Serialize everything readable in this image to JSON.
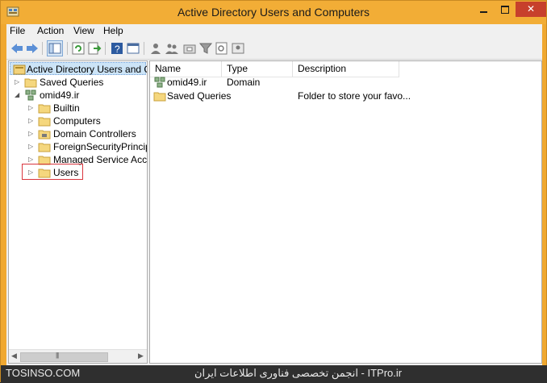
{
  "window": {
    "title": "Active Directory Users and Computers",
    "close_label": "✕"
  },
  "menu": {
    "file": "File",
    "action": "Action",
    "view": "View",
    "help": "Help"
  },
  "colors": {
    "accent_frame": "#f2ad36",
    "selection": "#cce4f7",
    "highlight_box": "#d9363e"
  },
  "tree": {
    "root": "Active Directory Users and Com",
    "saved_queries": "Saved Queries",
    "domain": "omid49.ir",
    "children": {
      "builtin": "Builtin",
      "computers": "Computers",
      "domain_controllers": "Domain Controllers",
      "foreign_security_principals": "ForeignSecurityPrincipals",
      "managed_service_accounts": "Managed Service Accour",
      "users": "Users"
    }
  },
  "list": {
    "headers": {
      "name": "Name",
      "type": "Type",
      "description": "Description"
    },
    "rows": [
      {
        "name": "omid49.ir",
        "type": "Domain",
        "description": ""
      },
      {
        "name": "Saved Queries",
        "type": "",
        "description": "Folder to store your favo..."
      }
    ]
  },
  "footer": {
    "left": "TOSINSO.COM",
    "right": "انجمن تخصصی فناوری اطلاعات ایران - ITPro.ir"
  }
}
